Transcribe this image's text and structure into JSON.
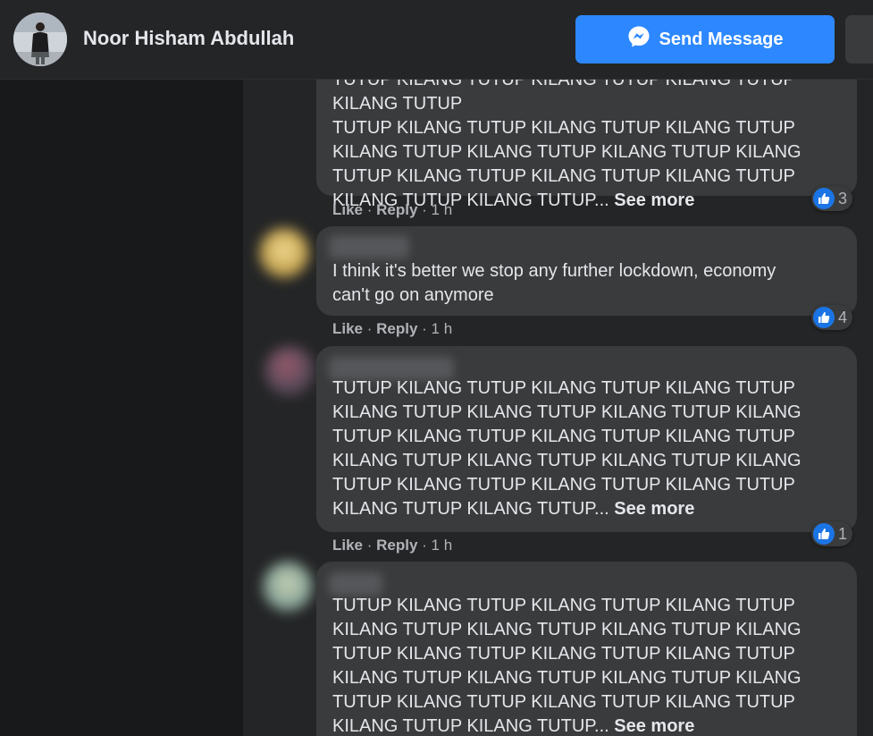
{
  "header": {
    "name": "Noor Hisham Abdullah",
    "send_label": "Send Message"
  },
  "comments": [
    {
      "text": "TUTUP KILANG TUTUP KILANG TUTUP KILANG TUTUP KILANG TUTUP\nTUTUP KILANG TUTUP KILANG TUTUP KILANG TUTUP\nKILANG TUTUP KILANG TUTUP KILANG TUTUP KILANG\nTUTUP KILANG TUTUP KILANG TUTUP KILANG TUTUP\nKILANG TUTUP KILANG TUTUP...",
      "see_more": "See more",
      "like": "Like",
      "reply": "Reply",
      "time": "1 h",
      "reactions": "3"
    },
    {
      "text": "I think it's better we stop any further lockdown, economy\ncan't go on anymore",
      "like": "Like",
      "reply": "Reply",
      "time": "1 h",
      "reactions": "4"
    },
    {
      "text": "TUTUP KILANG TUTUP KILANG TUTUP KILANG TUTUP\nKILANG TUTUP KILANG TUTUP KILANG TUTUP KILANG\nTUTUP KILANG TUTUP KILANG TUTUP KILANG TUTUP\nKILANG TUTUP KILANG TUTUP KILANG TUTUP KILANG\nTUTUP KILANG TUTUP KILANG TUTUP KILANG TUTUP\nKILANG TUTUP KILANG TUTUP...",
      "see_more": "See more",
      "like": "Like",
      "reply": "Reply",
      "time": "1 h",
      "reactions": "1"
    },
    {
      "text": "TUTUP KILANG TUTUP KILANG TUTUP KILANG TUTUP\nKILANG TUTUP KILANG TUTUP KILANG TUTUP KILANG\nTUTUP KILANG TUTUP KILANG TUTUP KILANG TUTUP\nKILANG TUTUP KILANG TUTUP KILANG TUTUP KILANG\nTUTUP KILANG TUTUP KILANG TUTUP KILANG TUTUP\nKILANG TUTUP KILANG TUTUP...",
      "see_more": "See more"
    }
  ],
  "colors": {
    "accent": "#2d88ff",
    "like_badge": "#1b74e4",
    "bubble": "#3a3b3c"
  }
}
